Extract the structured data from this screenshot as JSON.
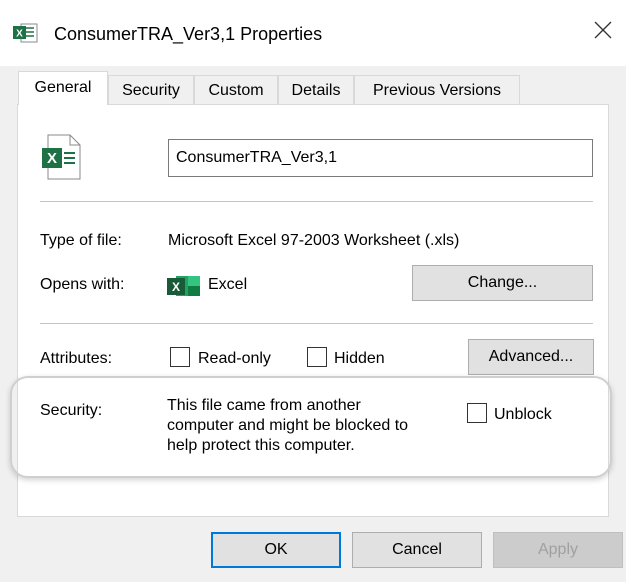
{
  "window": {
    "title": "ConsumerTRA_Ver3,1 Properties",
    "close_glyph": "✕"
  },
  "tabs": [
    {
      "label": "General",
      "active": true
    },
    {
      "label": "Security",
      "active": false
    },
    {
      "label": "Custom",
      "active": false
    },
    {
      "label": "Details",
      "active": false
    },
    {
      "label": "Previous Versions",
      "active": false
    }
  ],
  "general": {
    "file_name": "ConsumerTRA_Ver3,1",
    "file_icon": "excel-file-icon",
    "type_label": "Type of file:",
    "type_value": "Microsoft Excel 97-2003 Worksheet (.xls)",
    "opens_label": "Opens with:",
    "opens_app": "Excel",
    "opens_icon": "excel-app-icon",
    "change_button": "Change...",
    "attributes_label": "Attributes:",
    "readonly_label": "Read-only",
    "readonly_checked": false,
    "hidden_label": "Hidden",
    "hidden_checked": false,
    "advanced_button": "Advanced...",
    "security_label": "Security:",
    "security_line1": "This file came from another",
    "security_line2": "computer and might be blocked to",
    "security_line3": "help protect this computer.",
    "unblock_label": "Unblock",
    "unblock_checked": false
  },
  "footer": {
    "ok": "OK",
    "cancel": "Cancel",
    "apply": "Apply",
    "apply_enabled": false
  },
  "colors": {
    "excel_green": "#1e7145",
    "focus_blue": "#0078d7",
    "dialog_bg": "#f0f0f0"
  }
}
